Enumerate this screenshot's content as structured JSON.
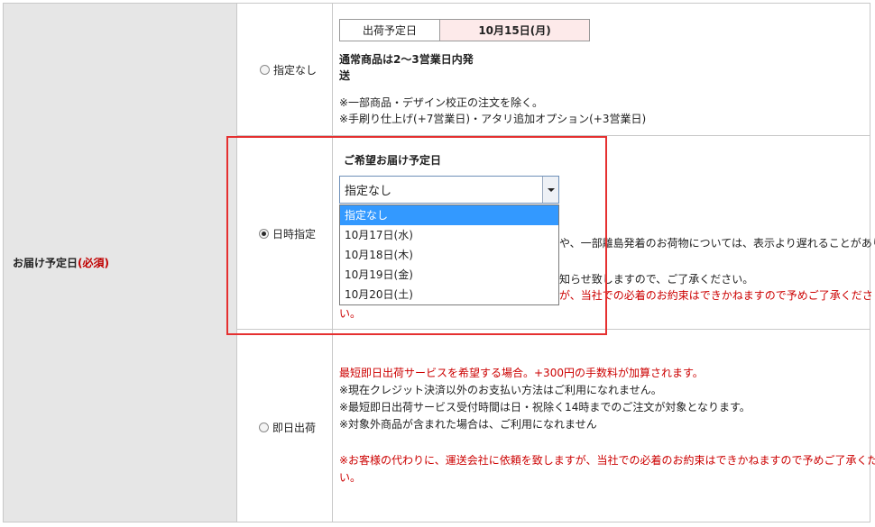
{
  "field": {
    "label": "お届け予定日",
    "required": "(必須)"
  },
  "options": {
    "none": {
      "label": "指定なし",
      "selected": false
    },
    "datetime": {
      "label": "日時指定",
      "selected": true
    },
    "sameday": {
      "label": "即日出荷",
      "selected": false
    }
  },
  "ship_info": {
    "key": "出荷予定日",
    "value": "10月15日(月)",
    "notice_line1": "通常商品は2〜3営業日内発",
    "notice_line2": "送",
    "note1": "※一部商品・デザイン校正の注文を除く。",
    "note2": "※手刷り仕上げ(+7営業日)・アタリ追加オプション(+3営業日)"
  },
  "delivery": {
    "heading": "ご希望お届け予定日",
    "selected_value": "指定なし",
    "dropdown_options": [
      "指定なし",
      "10月17日(水)",
      "10月18日(木)",
      "10月19日(金)",
      "10月20日(土)"
    ],
    "partial_text1": "や、一部離島発着のお荷物については、表示より遅れることがあり",
    "partial_text2": "知らせ致しますので、ご了承ください。",
    "partial_text3": "が、当社での必着のお約束はできかねますので予めご了承くださ",
    "partial_text4": "い。"
  },
  "sameday": {
    "line1": "最短即日出荷サービスを希望する場合。+300円の手数料が加算されます。",
    "line2": "※現在クレジット決済以外のお支払い方法はご利用になれません。",
    "line3": "※最短即日出荷サービス受付時間は日・祝除く14時までのご注文が対象となります。",
    "line4": "※対象外商品が含まれた場合は、ご利用になれません",
    "line5": "※お客様の代わりに、運送会社に依頼を致しますが、当社での必着のお約束はできかねますので予めご了承くださ",
    "line6": "い。"
  },
  "colors": {
    "required": "#cc0000",
    "highlight": "#e53030",
    "dropdown_selected": "#3399ff",
    "date_bg": "#fdeaea"
  }
}
